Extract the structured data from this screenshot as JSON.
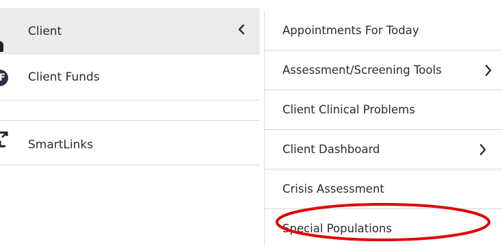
{
  "sidebar": {
    "items": [
      {
        "label": "Client",
        "icon": "person-icon",
        "active": true
      },
      {
        "label": "Client Funds",
        "icon": "client-funds-icon",
        "icon_letter": "F"
      },
      {
        "label": ""
      },
      {
        "label": "SmartLinks",
        "icon": "smartlinks-icon"
      }
    ],
    "collapse_icon": "chevron-left-icon"
  },
  "flyout": {
    "items": [
      {
        "label": "Appointments For Today",
        "has_submenu": false
      },
      {
        "label": "Assessment/Screening Tools",
        "has_submenu": true
      },
      {
        "label": "Client Clinical Problems",
        "has_submenu": false
      },
      {
        "label": "Client Dashboard",
        "has_submenu": true
      },
      {
        "label": "Crisis Assessment",
        "has_submenu": false
      },
      {
        "label": "Special Populations",
        "has_submenu": false,
        "highlighted": true
      }
    ]
  },
  "annotation": {
    "shape": "ellipse",
    "color": "#e00000",
    "target": "Special Populations"
  },
  "colors": {
    "active_bg": "#ebebeb",
    "divider": "#d6d6d6",
    "text": "#2b2b2b"
  }
}
